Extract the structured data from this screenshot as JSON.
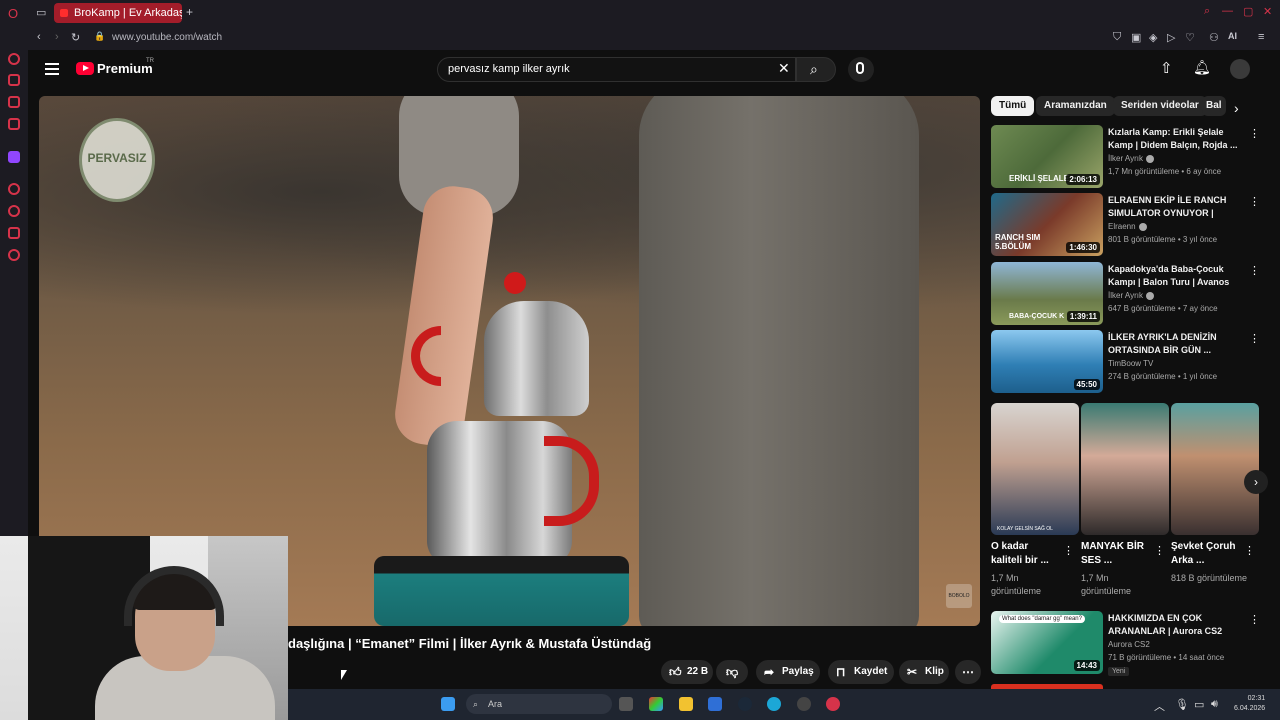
{
  "browser": {
    "tab_title": "BroKamp | Ev Arkadaşı",
    "new_tab_label": "+",
    "url": "www.youtube.com/watch",
    "ai_label": "AI"
  },
  "header": {
    "logo_text": "Premium",
    "tr_badge": "TR",
    "search_query": "pervasız kamp ilker ayrık"
  },
  "video": {
    "channel_logo_text": "PERVASIZ",
    "watermark_text": "BOBOLO",
    "title": "daşlığına | “Emanet” Filmi | İlker Ayrık & Mustafa Üstündağ",
    "like_count": "22 B",
    "share_label": "Paylaş",
    "save_label": "Kaydet",
    "clip_label": "Klip"
  },
  "chips": [
    "Tümü",
    "Aramanızdan",
    "Seriden videolar",
    "Bal"
  ],
  "recommendations": [
    {
      "title": "Kızlarla Kamp: Erikli Şelale Kamp | Didem Balçın, Rojda ...",
      "channel": "İlker Ayrık",
      "verified": true,
      "meta": "1,7 Mn görüntüleme • 6 ay önce",
      "duration": "2:06:13",
      "thumb_text": "ERİKLİ ŞELALE",
      "thumb_color": "#4d6a3a"
    },
    {
      "title": "ELRAENN EKİP İLE RANCH SIMULATOR OYNUYOR | TEMİ...",
      "channel": "Elraenn",
      "verified": true,
      "meta": "801 B görüntüleme • 3 yıl önce",
      "duration": "1:46:30",
      "thumb_text": "RANCH SIM 5.BÖLÜM",
      "thumb_color": "#7a3a2a"
    },
    {
      "title": "Kapadokya'da Baba-Çocuk Kampı | Balon Turu | Avanos v...",
      "channel": "İlker Ayrık",
      "verified": true,
      "meta": "647 B görüntüleme • 7 ay önce",
      "duration": "1:39:11",
      "thumb_text": "BABA-ÇOCUK K",
      "thumb_color": "#6a7a4a"
    },
    {
      "title": "İLKER AYRIK'LA DENİZİN ORTASINDA BİR GÜN ...",
      "channel": "TimBoow TV",
      "verified": false,
      "meta": "274 B görüntüleme • 1 yıl önce",
      "duration": "45:50",
      "thumb_text": "",
      "thumb_color": "#2f7fb5"
    }
  ],
  "shorts": [
    {
      "title": "O kadar kaliteli bir ...",
      "views": "1,7 Mn görüntüleme",
      "thumb_text": "KOLAY GELSİN SAĞ OL",
      "thumb_color": "#3a4e66"
    },
    {
      "title": "MANYAK BİR SES ...",
      "views": "1,7 Mn görüntüleme",
      "thumb_text": "",
      "thumb_color": "#2e5a55"
    },
    {
      "title": "Şevket Çoruh Arka ...",
      "views": "818 B görüntüleme",
      "thumb_text": "",
      "thumb_color": "#5a4030"
    }
  ],
  "last_rec": {
    "title": "HAKKIMIZDA EN ÇOK ARANANLAR | Aurora CS2",
    "channel": "Aurora CS2",
    "meta": "71 B görüntüleme • 14 saat önce",
    "badge": "Yeni",
    "duration": "14:43",
    "thumb_text": "What does \"damar gg\" mean?",
    "thumb_color": "#1f8a6a"
  },
  "taskbar": {
    "search_placeholder": "Ara",
    "time": "02:31",
    "date": "6.04.2026"
  }
}
